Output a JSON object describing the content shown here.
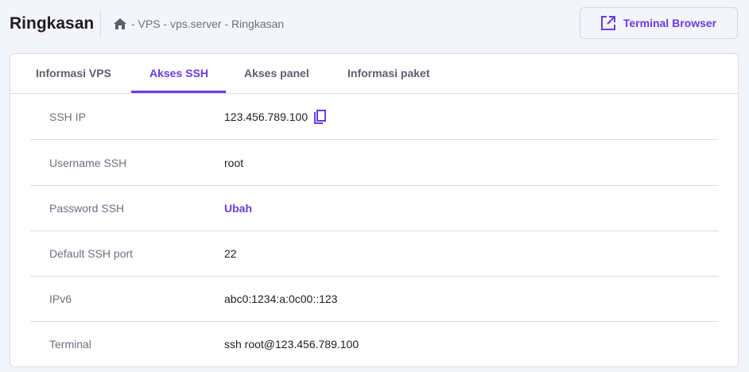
{
  "header": {
    "title": "Ringkasan",
    "breadcrumb": "- VPS - vps.server - Ringkasan",
    "terminal_button": "Terminal Browser"
  },
  "tabs": [
    {
      "label": "Informasi VPS"
    },
    {
      "label": "Akses SSH"
    },
    {
      "label": "Akses panel"
    },
    {
      "label": "Informasi paket"
    }
  ],
  "rows": [
    {
      "label": "SSH IP",
      "value": "123.456.789.100"
    },
    {
      "label": "Username SSH",
      "value": "root"
    },
    {
      "label": "Password SSH",
      "value": "Ubah"
    },
    {
      "label": "Default SSH port",
      "value": "22"
    },
    {
      "label": "IPv6",
      "value": "abc0:1234:a:0c00::123"
    },
    {
      "label": "Terminal",
      "value": "ssh root@123.456.789.100"
    }
  ],
  "colors": {
    "accent": "#673de6"
  }
}
